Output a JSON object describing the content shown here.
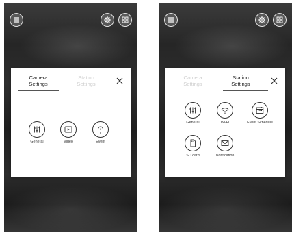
{
  "screens": [
    {
      "tabs": [
        {
          "label": "Camera\nSettings",
          "active": true
        },
        {
          "label": "Station\nSettings",
          "active": false
        }
      ],
      "items": [
        {
          "label": "General",
          "icon": "sliders-icon"
        },
        {
          "label": "Video",
          "icon": "play-icon"
        },
        {
          "label": "Event",
          "icon": "bell-icon"
        }
      ]
    },
    {
      "tabs": [
        {
          "label": "Camera\nSettings",
          "active": false
        },
        {
          "label": "Station\nSettings",
          "active": true
        }
      ],
      "items": [
        {
          "label": "General",
          "icon": "sliders-icon"
        },
        {
          "label": "Wi-Fi",
          "icon": "wifi-icon"
        },
        {
          "label": "Event Schedule",
          "icon": "calendar-icon"
        },
        {
          "label": "SD card",
          "icon": "sd-card-icon"
        },
        {
          "label": "Notification",
          "icon": "envelope-icon"
        }
      ]
    }
  ],
  "colors": {
    "dialog_bg": "#ffffff",
    "active_tab": "#222222",
    "inactive_tab": "#cfcfcf",
    "icon_stroke": "#333333"
  }
}
